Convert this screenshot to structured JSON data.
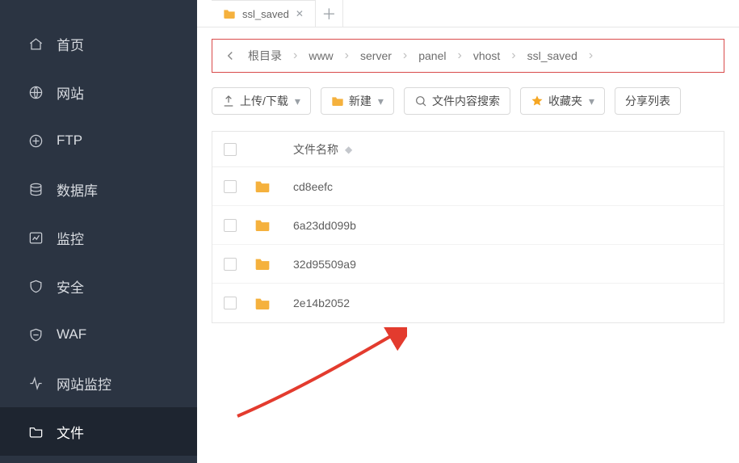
{
  "sidebar": {
    "items": [
      {
        "label": "首页"
      },
      {
        "label": "网站"
      },
      {
        "label": "FTP"
      },
      {
        "label": "数据库"
      },
      {
        "label": "监控"
      },
      {
        "label": "安全"
      },
      {
        "label": "WAF"
      },
      {
        "label": "网站监控"
      },
      {
        "label": "文件"
      }
    ]
  },
  "tab": {
    "label": "ssl_saved"
  },
  "breadcrumb": {
    "root": "根目录",
    "parts": [
      "www",
      "server",
      "panel",
      "vhost",
      "ssl_saved"
    ]
  },
  "toolbar": {
    "upload": "上传/下载",
    "newBtn": "新建",
    "search": "文件内容搜索",
    "fav": "收藏夹",
    "share": "分享列表"
  },
  "columns": {
    "name": "文件名称"
  },
  "files": [
    {
      "name": "cd8eefc"
    },
    {
      "name": "6a23dd099b"
    },
    {
      "name": "32d95509a9"
    },
    {
      "name": "2e14b2052"
    }
  ]
}
